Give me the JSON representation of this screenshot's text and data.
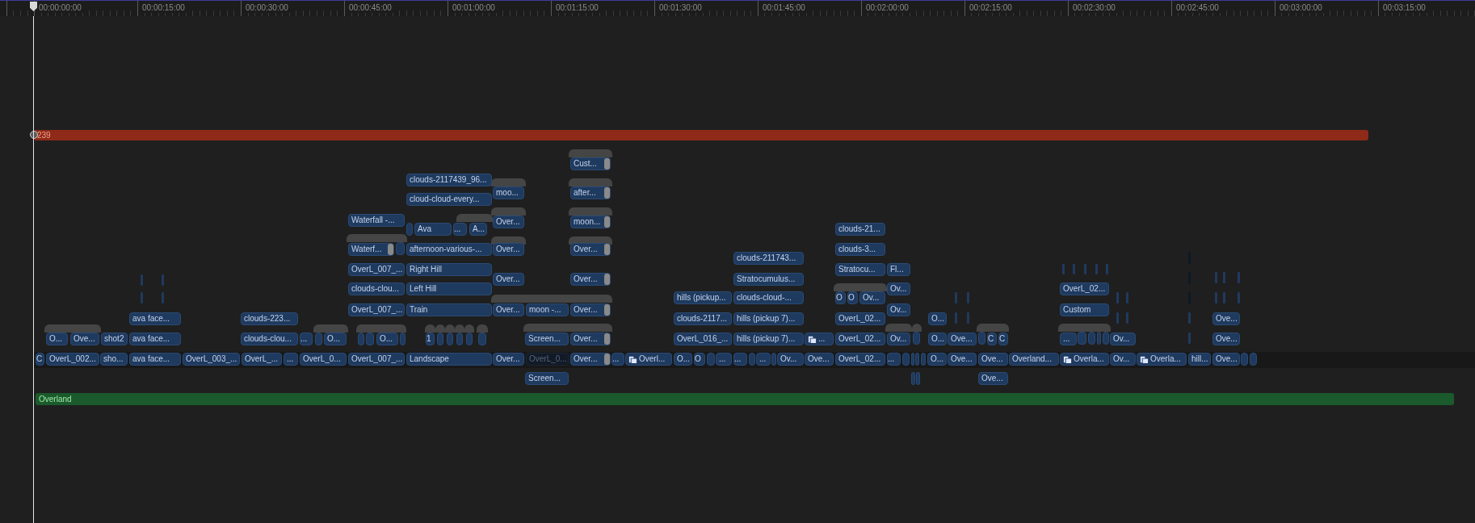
{
  "ruler": {
    "timecodes": [
      "00:00:00:00",
      "00:00:15:00",
      "00:00:30:00",
      "00:00:45:00",
      "00:01:00:00",
      "00:01:15:00",
      "00:01:30:00",
      "00:01:45:00",
      "00:02:00:00",
      "00:02:15:00",
      "00:02:30:00",
      "00:02:45:00",
      "00:03:00:00",
      "00:03:15:00"
    ]
  },
  "range_bar": {
    "label": "239"
  },
  "clips": [
    {
      "label": "Cust...",
      "kind": "handle"
    },
    {
      "label": "clouds-2117439_96...",
      "kind": "plain"
    },
    {
      "label": "moo...",
      "kind": "plain"
    },
    {
      "label": "after...",
      "kind": "handle"
    },
    {
      "label": "cloud-cloud-every...",
      "kind": "plain"
    },
    {
      "label": "Waterfall -...",
      "kind": "plain"
    },
    {
      "label": "Over...",
      "kind": "plain"
    },
    {
      "label": "moon...",
      "kind": "handle"
    },
    {
      "label": "Ava",
      "kind": "plain"
    },
    {
      "label": "...",
      "kind": "plain"
    },
    {
      "label": "A...",
      "kind": "plain"
    },
    {
      "label": "clouds-21...",
      "kind": "plain"
    },
    {
      "label": "Waterf...",
      "kind": "handle"
    },
    {
      "label": "afternoon-various-...",
      "kind": "plain"
    },
    {
      "label": "Over...",
      "kind": "plain"
    },
    {
      "label": "Over...",
      "kind": "handle"
    },
    {
      "label": "clouds-3...",
      "kind": "plain"
    },
    {
      "label": "clouds-211743...",
      "kind": "plain"
    },
    {
      "label": "OverL_007_...",
      "kind": "plain"
    },
    {
      "label": "Right Hill",
      "kind": "plain"
    },
    {
      "label": "Stratocu...",
      "kind": "plain"
    },
    {
      "label": "Fl...",
      "kind": "plain"
    },
    {
      "label": "Over...",
      "kind": "plain"
    },
    {
      "label": "Over...",
      "kind": "handle"
    },
    {
      "label": "Stratocumulus...",
      "kind": "plain"
    },
    {
      "label": "clouds-clou...",
      "kind": "plain"
    },
    {
      "label": "Left Hill",
      "kind": "plain"
    },
    {
      "label": "Ov...",
      "kind": "plain"
    },
    {
      "label": "OverL_02...",
      "kind": "plain"
    },
    {
      "label": "hills (pickup...",
      "kind": "plain"
    },
    {
      "label": "clouds-cloud-...",
      "kind": "plain"
    },
    {
      "label": "O",
      "kind": "plain"
    },
    {
      "label": "O",
      "kind": "plain"
    },
    {
      "label": "Ov...",
      "kind": "plain"
    },
    {
      "label": "OverL_007_...",
      "kind": "plain"
    },
    {
      "label": "Train",
      "kind": "plain"
    },
    {
      "label": "Over...",
      "kind": "plain"
    },
    {
      "label": "moon -...",
      "kind": "plain"
    },
    {
      "label": "Over...",
      "kind": "handle"
    },
    {
      "label": "Ov...",
      "kind": "plain"
    },
    {
      "label": "Custom",
      "kind": "plain"
    },
    {
      "label": "ava face...",
      "kind": "plain"
    },
    {
      "label": "clouds-223...",
      "kind": "plain"
    },
    {
      "label": "clouds-2117...",
      "kind": "plain"
    },
    {
      "label": "hills (pickup 7)...",
      "kind": "plain"
    },
    {
      "label": "OverL_02...",
      "kind": "plain"
    },
    {
      "label": "O...",
      "kind": "plain"
    },
    {
      "label": "Ove...",
      "kind": "plain"
    },
    {
      "label": "O...",
      "kind": "plain"
    },
    {
      "label": "Ove...",
      "kind": "plain"
    },
    {
      "label": "shot2",
      "kind": "plain"
    },
    {
      "label": "ava face...",
      "kind": "plain"
    },
    {
      "label": "clouds-clou...",
      "kind": "plain"
    },
    {
      "label": "...",
      "kind": "plain"
    },
    {
      "label": "O...",
      "kind": "plain"
    },
    {
      "label": "O...",
      "kind": "plain"
    },
    {
      "label": "1",
      "kind": "plain"
    },
    {
      "label": "Screen...",
      "kind": "plain"
    },
    {
      "label": "Over...",
      "kind": "handle"
    },
    {
      "label": "OverL_016_...",
      "kind": "plain"
    },
    {
      "label": "hills (pickup 7)...",
      "kind": "plain"
    },
    {
      "label": "...",
      "kind": "icon"
    },
    {
      "label": "OverL_02...",
      "kind": "plain"
    },
    {
      "label": "Ov...",
      "kind": "plain"
    },
    {
      "label": "O...",
      "kind": "plain"
    },
    {
      "label": "Ove...",
      "kind": "plain"
    },
    {
      "label": "C",
      "kind": "plain"
    },
    {
      "label": "C",
      "kind": "plain"
    },
    {
      "label": "...",
      "kind": "plain"
    },
    {
      "label": "Ov...",
      "kind": "plain"
    },
    {
      "label": "Ove...",
      "kind": "plain"
    },
    {
      "label": "C",
      "kind": "plain"
    },
    {
      "label": "OverL_002...",
      "kind": "plain"
    },
    {
      "label": "sho...",
      "kind": "plain"
    },
    {
      "label": "ava face...",
      "kind": "plain"
    },
    {
      "label": "OverL_003_...",
      "kind": "plain"
    },
    {
      "label": "OverL_...",
      "kind": "plain"
    },
    {
      "label": "...",
      "kind": "plain"
    },
    {
      "label": "OverL_0...",
      "kind": "plain"
    },
    {
      "label": "OverL_007_...",
      "kind": "plain"
    },
    {
      "label": "Landscape",
      "kind": "plain"
    },
    {
      "label": "Over...",
      "kind": "plain"
    },
    {
      "label": "OverL_0...",
      "kind": "dimmed"
    },
    {
      "label": "Over...",
      "kind": "handle"
    },
    {
      "label": "...",
      "kind": "plain"
    },
    {
      "label": "Overl...",
      "kind": "icon"
    },
    {
      "label": "O...",
      "kind": "plain"
    },
    {
      "label": "O",
      "kind": "plain"
    },
    {
      "label": "...",
      "kind": "plain"
    },
    {
      "label": "...",
      "kind": "plain"
    },
    {
      "label": "...",
      "kind": "plain"
    },
    {
      "label": "Ov...",
      "kind": "plain"
    },
    {
      "label": "Ove...",
      "kind": "plain"
    },
    {
      "label": "OverL_02...",
      "kind": "plain"
    },
    {
      "label": "...",
      "kind": "plain"
    },
    {
      "label": "O...",
      "kind": "plain"
    },
    {
      "label": "Ove...",
      "kind": "plain"
    },
    {
      "label": "Ove...",
      "kind": "plain"
    },
    {
      "label": "Overland...",
      "kind": "plain"
    },
    {
      "label": "Overla...",
      "kind": "icon"
    },
    {
      "label": "Ov...",
      "kind": "plain"
    },
    {
      "label": "Overla...",
      "kind": "icon"
    },
    {
      "label": "hill...",
      "kind": "plain"
    },
    {
      "label": "Ove...",
      "kind": "plain"
    },
    {
      "label": "Screen...",
      "kind": "plain"
    },
    {
      "label": "Ove...",
      "kind": "plain"
    }
  ],
  "storyline": {
    "label": "Overland"
  }
}
